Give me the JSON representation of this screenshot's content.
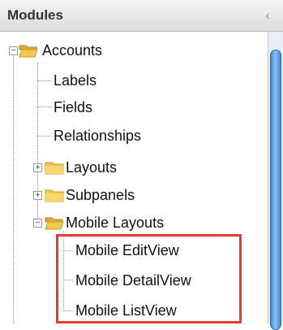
{
  "panel": {
    "title": "Modules",
    "collapse_glyph": "‹",
    "scroll_position": 0.0
  },
  "tree": {
    "accounts": {
      "label": "Accounts",
      "expanded": true,
      "children": {
        "labels": "Labels",
        "fields": "Fields",
        "relationships": "Relationships",
        "layouts": "Layouts",
        "subpanels": "Subpanels",
        "mobile_layouts": {
          "label": "Mobile Layouts",
          "expanded": true,
          "children": [
            "Mobile EditView",
            "Mobile DetailView",
            "Mobile ListView"
          ]
        }
      }
    }
  },
  "icons": {
    "folder_open": "folder-open-icon",
    "folder_closed": "folder-closed-icon",
    "expand": "plus-box-icon",
    "collapse": "minus-box-icon"
  },
  "colors": {
    "highlight": "#e53c30",
    "folder": "#f2c94c",
    "scrollbar": "#3f86d3"
  }
}
